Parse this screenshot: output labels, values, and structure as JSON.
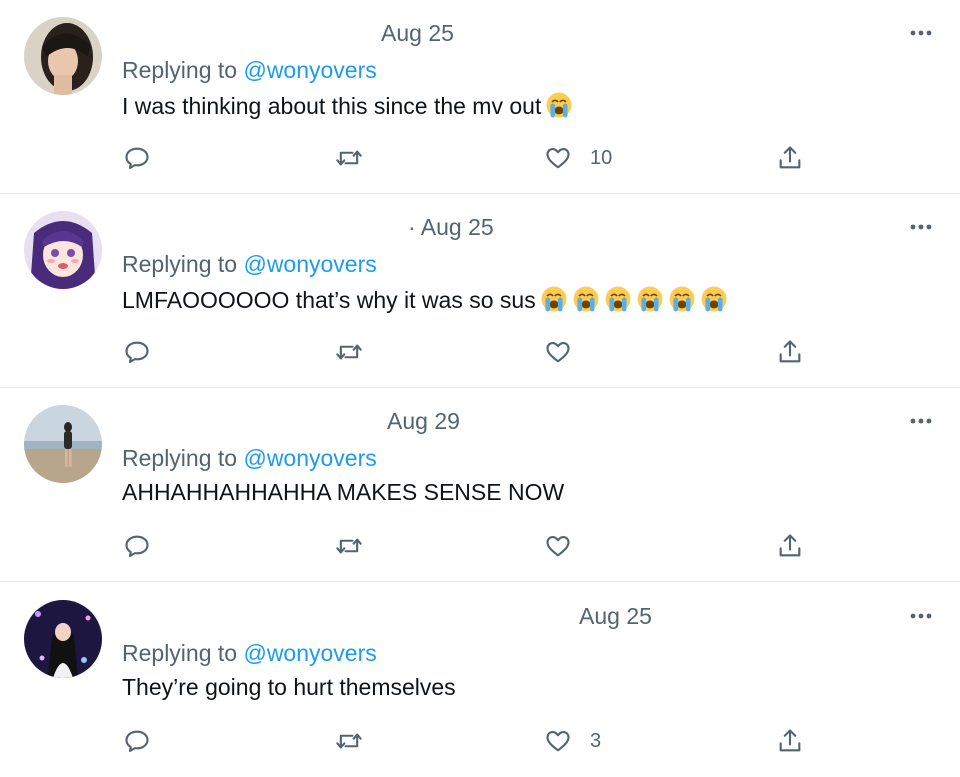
{
  "tweets": [
    {
      "date": "Aug 25",
      "replying_prefix": "Replying to",
      "handle": "@wonyovers",
      "text": "I was thinking about this since the mv out",
      "emoji": "loudly-crying-face",
      "emoji_count": 1,
      "likes": "10",
      "avatar": "portrait-dark-hair"
    },
    {
      "date": "· Aug 25",
      "replying_prefix": "Replying to",
      "handle": "@wonyovers",
      "text": "LMFAOOOOOO that’s why it was so sus",
      "emoji": "loudly-crying-face",
      "emoji_count": 6,
      "likes": "",
      "avatar": "anime-girl-purple-hair"
    },
    {
      "date": "Aug 29",
      "replying_prefix": "Replying to",
      "handle": "@wonyovers",
      "text": "AHHAHHAHHAHHA MAKES SENSE NOW",
      "emoji": "",
      "emoji_count": 0,
      "likes": "",
      "avatar": "person-on-beach"
    },
    {
      "date": "Aug 25",
      "replying_prefix": "Replying to",
      "handle": "@wonyovers",
      "text": "They’re going to hurt themselves",
      "emoji": "",
      "emoji_count": 0,
      "likes": "3",
      "avatar": "performer-on-stage"
    }
  ],
  "colors": {
    "secondary_text": "#536471",
    "link": "#1d9bf0",
    "divider": "#e7eaed",
    "primary_text": "#0f1419"
  }
}
